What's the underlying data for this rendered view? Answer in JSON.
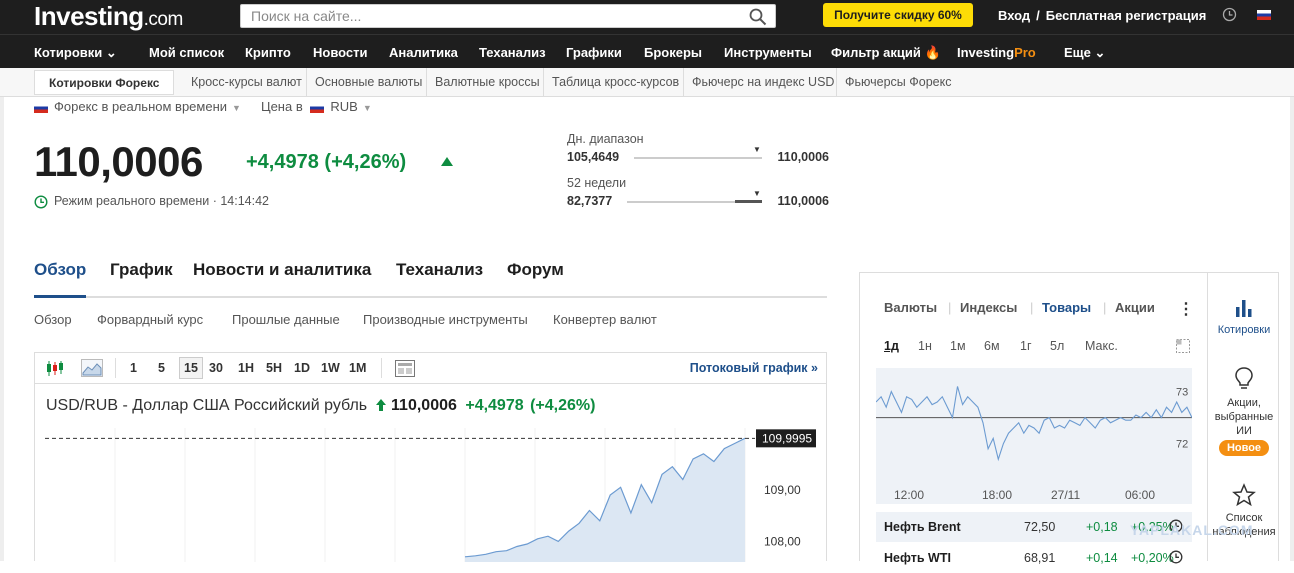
{
  "header": {
    "logo_main": "Investing",
    "logo_suffix": ".com",
    "search_placeholder": "Поиск на сайте...",
    "promo_label": "Получите скидку 60%",
    "login": "Вход",
    "login_sep": "/",
    "register": "Бесплатная регистрация"
  },
  "nav": {
    "items": [
      "Котировки",
      "Мой список",
      "Крипто",
      "Новости",
      "Аналитика",
      "Теханализ",
      "Графики",
      "Брокеры",
      "Инструменты",
      "Фильтр акций"
    ],
    "pro_part1": "Investing",
    "pro_part2": "Pro",
    "more": "Еще"
  },
  "subnav": {
    "active": "Котировки Форекс",
    "items": [
      "Кросс-курсы валют",
      "Основные валюты",
      "Валютные кроссы",
      "Таблица кросс-курсов",
      "Фьючерс на индекс USD",
      "Фьючерсы Форекс"
    ]
  },
  "quote": {
    "market_label": "Форекс в реальном времени",
    "price_in_label": "Цена в",
    "currency": "RUB",
    "price": "110,0006",
    "change": "+4,4978",
    "change_pct": "(+4,26%)",
    "realtime_label": "Режим реального времени",
    "time": "· 14:14:42",
    "day_range_label": "Дн. диапазон",
    "day_low": "105,4649",
    "day_high": "110,0006",
    "day_position": 1.0,
    "week52_label": "52 недели",
    "week52_low": "82,7377",
    "week52_high": "110,0006",
    "week52_position": 1.0
  },
  "tabs": [
    "Обзор",
    "График",
    "Новости и аналитика",
    "Теханализ",
    "Форум"
  ],
  "subtabs": [
    "Обзор",
    "Форвардный курс",
    "Прошлые данные",
    "Производные инструменты",
    "Конвертер валют"
  ],
  "chart_toolbar": {
    "intervals": [
      "1",
      "5",
      "15",
      "30",
      "1H",
      "5H",
      "1D",
      "1W",
      "1M"
    ],
    "selected": "15",
    "stream_label": "Потоковый график »"
  },
  "chart_header": {
    "symbol": "USD/RUB - Доллар США Российский рубль",
    "price": "110,0006",
    "change": "+4,4978",
    "change_pct": "(+4,26%)"
  },
  "chart_data": [
    {
      "type": "area",
      "title": "USD/RUB - Доллар США Российский рубль",
      "y_ticks": [
        "109,00",
        "108,00"
      ],
      "last_value_label": "109,9995",
      "ylim": [
        107.6,
        110.2
      ],
      "x": [
        0,
        1,
        2,
        3,
        4,
        5,
        6,
        7,
        8,
        9,
        10,
        11,
        12,
        13,
        14,
        15,
        16,
        17,
        18,
        19,
        20,
        21,
        22,
        23,
        24,
        25,
        26,
        27
      ],
      "values": [
        107.7,
        107.72,
        107.75,
        107.8,
        107.82,
        107.9,
        107.95,
        108.05,
        108.1,
        108.0,
        108.2,
        108.35,
        108.6,
        108.4,
        108.9,
        109.05,
        108.55,
        109.1,
        108.75,
        109.3,
        109.45,
        109.2,
        109.6,
        109.7,
        109.55,
        109.8,
        109.9,
        109.9995
      ]
    },
    {
      "type": "line",
      "title": "Нефть Brent",
      "x_ticks": [
        "12:00",
        "18:00",
        "27/11",
        "06:00"
      ],
      "y_ticks": [
        "73",
        "72"
      ],
      "ylim": [
        71.3,
        73.3
      ],
      "reference_value": 72.5,
      "values": [
        72.8,
        72.9,
        72.7,
        73.0,
        72.8,
        72.6,
        72.9,
        72.85,
        72.7,
        72.8,
        72.9,
        72.75,
        72.8,
        72.9,
        72.7,
        72.5,
        73.1,
        72.75,
        72.9,
        72.8,
        72.7,
        72.4,
        71.9,
        72.1,
        71.7,
        72.0,
        72.2,
        72.3,
        72.4,
        72.2,
        72.35,
        72.3,
        72.2,
        72.45,
        72.5,
        72.3,
        72.35,
        72.3,
        72.45,
        72.4,
        72.35,
        72.5,
        72.4,
        72.3,
        72.45,
        72.5,
        72.4,
        72.45,
        72.5,
        72.45,
        72.45,
        72.55,
        72.5,
        72.6,
        72.5,
        72.65,
        72.5,
        72.7,
        72.6,
        72.8,
        72.6,
        72.7,
        72.5
      ]
    }
  ],
  "right_panel": {
    "tabs": [
      "Валюты",
      "Индексы",
      "Товары",
      "Акции"
    ],
    "active_tab": "Товары",
    "periods": [
      "1д",
      "1н",
      "1м",
      "6м",
      "1г",
      "5л",
      "Макс."
    ],
    "active_period": "1д",
    "rows": [
      {
        "name": "Нефть Brent",
        "value": "72,50",
        "change": "+0,18",
        "pct": "+0,25%"
      },
      {
        "name": "Нефть WTI",
        "value": "68,91",
        "change": "+0,14",
        "pct": "+0,20%"
      }
    ]
  },
  "sidebar": {
    "quotes": "Котировки",
    "ai_picks_line1": "Акции,",
    "ai_picks_line2": "выбранные",
    "ai_picks_line3": "ИИ",
    "new_badge": "Новое",
    "watchlist_line1": "Список",
    "watchlist_line2": "наблюдения"
  },
  "watermark": "YAPLAKAL.COM",
  "colors": {
    "dark_bg": "#1e1e1e",
    "accent_blue": "#1e4f8a",
    "up_green": "#0e8c40",
    "promo_yellow": "#fddc06",
    "pro_orange": "#f48f12"
  }
}
